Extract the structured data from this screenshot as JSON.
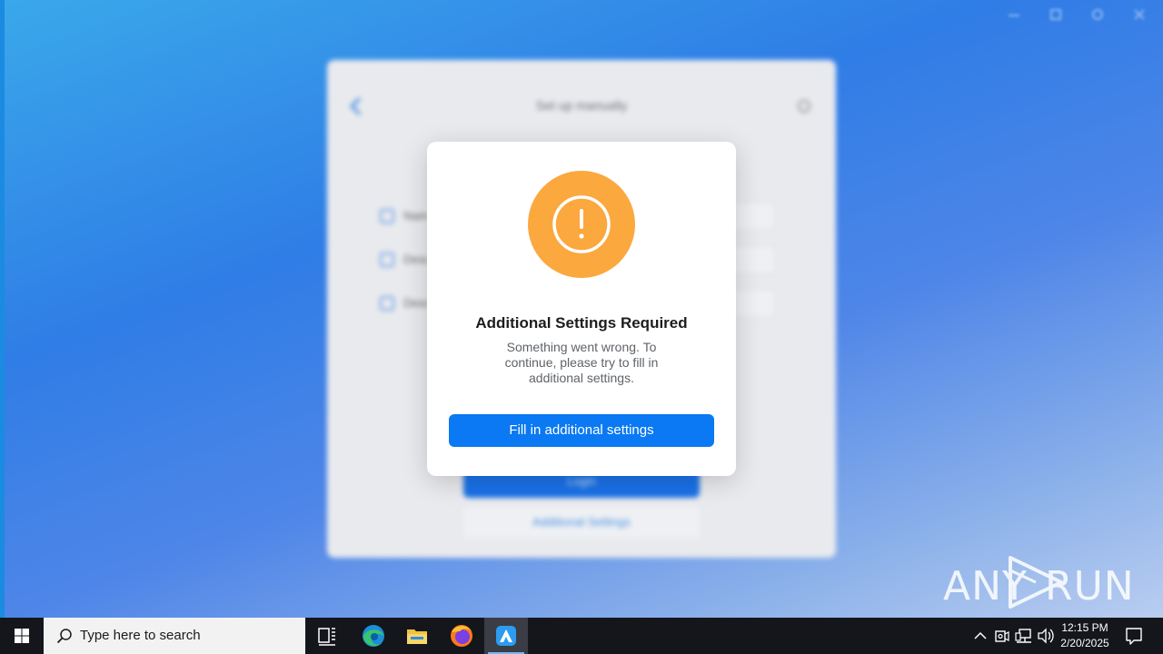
{
  "background_app": {
    "title": "Set up manually",
    "rows": [
      {
        "label": "Nam"
      },
      {
        "label": "Desc"
      },
      {
        "label": "Desc"
      }
    ],
    "login_label": "Login",
    "additional_settings_label": "Additional Settings"
  },
  "dialog": {
    "icon": "exclamation-icon",
    "title": "Additional Settings Required",
    "message": "Something went wrong. To continue, please try to fill in additional settings.",
    "primary_button": "Fill in additional settings",
    "accent_color": "#0a79f3",
    "warning_color": "#fba83e"
  },
  "watermark": {
    "text_left": "ANY",
    "text_right": "RUN"
  },
  "taskbar": {
    "search_placeholder": "Type here to search",
    "apps": [
      "task-view",
      "edge",
      "file-explorer",
      "firefox",
      "active-app"
    ],
    "clock": {
      "time": "12:15 PM",
      "date": "2/20/2025"
    }
  }
}
